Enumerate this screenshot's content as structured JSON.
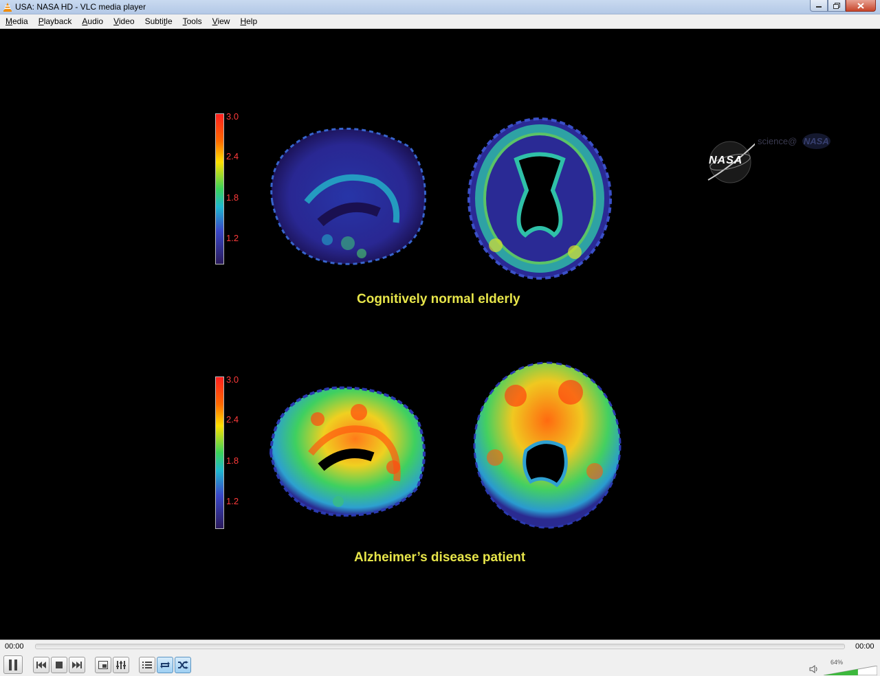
{
  "window": {
    "title": "USA: NASA HD - VLC media player"
  },
  "menu": [
    {
      "label": "Media",
      "key": "M",
      "rest": "edia"
    },
    {
      "label": "Playback",
      "key": "P",
      "rest": "layback"
    },
    {
      "label": "Audio",
      "key": "A",
      "rest": "udio"
    },
    {
      "label": "Video",
      "key": "V",
      "rest": "ideo"
    },
    {
      "label": "Subtitle",
      "pre": "Subti",
      "key": "t",
      "rest": "le"
    },
    {
      "label": "Tools",
      "key": "T",
      "rest": "ools"
    },
    {
      "label": "View",
      "key": "V",
      "rest": "iew"
    },
    {
      "label": "Help",
      "key": "H",
      "rest": "elp"
    }
  ],
  "video": {
    "scale_ticks": [
      "3.0",
      "2.4",
      "1.8",
      "1.2"
    ],
    "caption_top": "Cognitively normal elderly",
    "caption_bottom": "Alzheimer’s disease patient",
    "logo_text": "NASA",
    "watermark_text": "science@",
    "watermark_logo": "NASA"
  },
  "player": {
    "elapsed": "00:00",
    "total": "00:00",
    "volume_percent": "64%",
    "volume_level": 0.64,
    "accent": "#3cb83c"
  }
}
